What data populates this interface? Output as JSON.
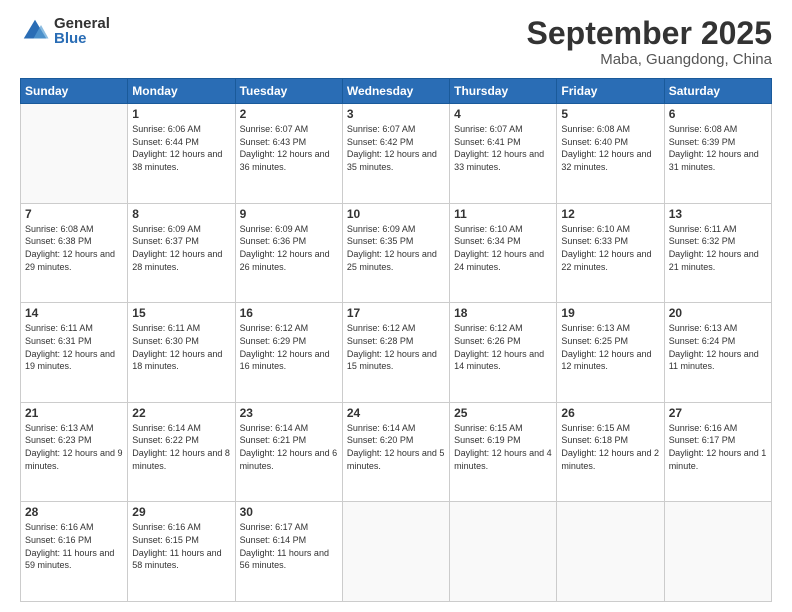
{
  "logo": {
    "general": "General",
    "blue": "Blue"
  },
  "header": {
    "month": "September 2025",
    "location": "Maba, Guangdong, China"
  },
  "weekdays": [
    "Sunday",
    "Monday",
    "Tuesday",
    "Wednesday",
    "Thursday",
    "Friday",
    "Saturday"
  ],
  "weeks": [
    [
      {
        "day": "",
        "sunrise": "",
        "sunset": "",
        "daylight": ""
      },
      {
        "day": "1",
        "sunrise": "Sunrise: 6:06 AM",
        "sunset": "Sunset: 6:44 PM",
        "daylight": "Daylight: 12 hours and 38 minutes."
      },
      {
        "day": "2",
        "sunrise": "Sunrise: 6:07 AM",
        "sunset": "Sunset: 6:43 PM",
        "daylight": "Daylight: 12 hours and 36 minutes."
      },
      {
        "day": "3",
        "sunrise": "Sunrise: 6:07 AM",
        "sunset": "Sunset: 6:42 PM",
        "daylight": "Daylight: 12 hours and 35 minutes."
      },
      {
        "day": "4",
        "sunrise": "Sunrise: 6:07 AM",
        "sunset": "Sunset: 6:41 PM",
        "daylight": "Daylight: 12 hours and 33 minutes."
      },
      {
        "day": "5",
        "sunrise": "Sunrise: 6:08 AM",
        "sunset": "Sunset: 6:40 PM",
        "daylight": "Daylight: 12 hours and 32 minutes."
      },
      {
        "day": "6",
        "sunrise": "Sunrise: 6:08 AM",
        "sunset": "Sunset: 6:39 PM",
        "daylight": "Daylight: 12 hours and 31 minutes."
      }
    ],
    [
      {
        "day": "7",
        "sunrise": "Sunrise: 6:08 AM",
        "sunset": "Sunset: 6:38 PM",
        "daylight": "Daylight: 12 hours and 29 minutes."
      },
      {
        "day": "8",
        "sunrise": "Sunrise: 6:09 AM",
        "sunset": "Sunset: 6:37 PM",
        "daylight": "Daylight: 12 hours and 28 minutes."
      },
      {
        "day": "9",
        "sunrise": "Sunrise: 6:09 AM",
        "sunset": "Sunset: 6:36 PM",
        "daylight": "Daylight: 12 hours and 26 minutes."
      },
      {
        "day": "10",
        "sunrise": "Sunrise: 6:09 AM",
        "sunset": "Sunset: 6:35 PM",
        "daylight": "Daylight: 12 hours and 25 minutes."
      },
      {
        "day": "11",
        "sunrise": "Sunrise: 6:10 AM",
        "sunset": "Sunset: 6:34 PM",
        "daylight": "Daylight: 12 hours and 24 minutes."
      },
      {
        "day": "12",
        "sunrise": "Sunrise: 6:10 AM",
        "sunset": "Sunset: 6:33 PM",
        "daylight": "Daylight: 12 hours and 22 minutes."
      },
      {
        "day": "13",
        "sunrise": "Sunrise: 6:11 AM",
        "sunset": "Sunset: 6:32 PM",
        "daylight": "Daylight: 12 hours and 21 minutes."
      }
    ],
    [
      {
        "day": "14",
        "sunrise": "Sunrise: 6:11 AM",
        "sunset": "Sunset: 6:31 PM",
        "daylight": "Daylight: 12 hours and 19 minutes."
      },
      {
        "day": "15",
        "sunrise": "Sunrise: 6:11 AM",
        "sunset": "Sunset: 6:30 PM",
        "daylight": "Daylight: 12 hours and 18 minutes."
      },
      {
        "day": "16",
        "sunrise": "Sunrise: 6:12 AM",
        "sunset": "Sunset: 6:29 PM",
        "daylight": "Daylight: 12 hours and 16 minutes."
      },
      {
        "day": "17",
        "sunrise": "Sunrise: 6:12 AM",
        "sunset": "Sunset: 6:28 PM",
        "daylight": "Daylight: 12 hours and 15 minutes."
      },
      {
        "day": "18",
        "sunrise": "Sunrise: 6:12 AM",
        "sunset": "Sunset: 6:26 PM",
        "daylight": "Daylight: 12 hours and 14 minutes."
      },
      {
        "day": "19",
        "sunrise": "Sunrise: 6:13 AM",
        "sunset": "Sunset: 6:25 PM",
        "daylight": "Daylight: 12 hours and 12 minutes."
      },
      {
        "day": "20",
        "sunrise": "Sunrise: 6:13 AM",
        "sunset": "Sunset: 6:24 PM",
        "daylight": "Daylight: 12 hours and 11 minutes."
      }
    ],
    [
      {
        "day": "21",
        "sunrise": "Sunrise: 6:13 AM",
        "sunset": "Sunset: 6:23 PM",
        "daylight": "Daylight: 12 hours and 9 minutes."
      },
      {
        "day": "22",
        "sunrise": "Sunrise: 6:14 AM",
        "sunset": "Sunset: 6:22 PM",
        "daylight": "Daylight: 12 hours and 8 minutes."
      },
      {
        "day": "23",
        "sunrise": "Sunrise: 6:14 AM",
        "sunset": "Sunset: 6:21 PM",
        "daylight": "Daylight: 12 hours and 6 minutes."
      },
      {
        "day": "24",
        "sunrise": "Sunrise: 6:14 AM",
        "sunset": "Sunset: 6:20 PM",
        "daylight": "Daylight: 12 hours and 5 minutes."
      },
      {
        "day": "25",
        "sunrise": "Sunrise: 6:15 AM",
        "sunset": "Sunset: 6:19 PM",
        "daylight": "Daylight: 12 hours and 4 minutes."
      },
      {
        "day": "26",
        "sunrise": "Sunrise: 6:15 AM",
        "sunset": "Sunset: 6:18 PM",
        "daylight": "Daylight: 12 hours and 2 minutes."
      },
      {
        "day": "27",
        "sunrise": "Sunrise: 6:16 AM",
        "sunset": "Sunset: 6:17 PM",
        "daylight": "Daylight: 12 hours and 1 minute."
      }
    ],
    [
      {
        "day": "28",
        "sunrise": "Sunrise: 6:16 AM",
        "sunset": "Sunset: 6:16 PM",
        "daylight": "Daylight: 11 hours and 59 minutes."
      },
      {
        "day": "29",
        "sunrise": "Sunrise: 6:16 AM",
        "sunset": "Sunset: 6:15 PM",
        "daylight": "Daylight: 11 hours and 58 minutes."
      },
      {
        "day": "30",
        "sunrise": "Sunrise: 6:17 AM",
        "sunset": "Sunset: 6:14 PM",
        "daylight": "Daylight: 11 hours and 56 minutes."
      },
      {
        "day": "",
        "sunrise": "",
        "sunset": "",
        "daylight": ""
      },
      {
        "day": "",
        "sunrise": "",
        "sunset": "",
        "daylight": ""
      },
      {
        "day": "",
        "sunrise": "",
        "sunset": "",
        "daylight": ""
      },
      {
        "day": "",
        "sunrise": "",
        "sunset": "",
        "daylight": ""
      }
    ]
  ]
}
